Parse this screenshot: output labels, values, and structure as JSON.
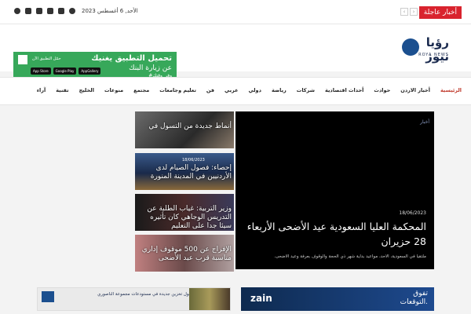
{
  "topbar": {
    "breaking_label": "أخبار عاجلة",
    "date": "الأحد, 6 أغسطس 2023",
    "social_icons": [
      "facebook-icon",
      "twitter-icon",
      "telegram-icon",
      "instagram-icon",
      "youtube-icon",
      "search-icon"
    ]
  },
  "header": {
    "logo_text": "رؤيا نيوز",
    "logo_sub": "ROYA NEWS",
    "app_banner": {
      "title": "تحميل التطبيق يغنيك",
      "subtitle": "عن زيارة البنك",
      "hashtag": "#وفر_وقتك",
      "cta": "حمّل التطبيق الآن",
      "stores": [
        "App Store",
        "Google Play",
        "AppGallery"
      ]
    }
  },
  "nav": {
    "items": [
      "الرئيسية",
      "أخبار الاردن",
      "حوادث",
      "أحداث اقتصادية",
      "شركات",
      "رياضة",
      "دولي",
      "عربي",
      "فن",
      "تعليم وجامعات",
      "مجتمع",
      "منوعات",
      "الخليج",
      "تقنية",
      "آراء"
    ]
  },
  "featured": {
    "tag": "أخبار",
    "date": "18/06/2023",
    "title": "المحكمة العليا السعودية عيد الأضحى الأربعاء 28 حزيران",
    "excerpt": "ملتقيا في السعودية، الأحد، مواعيد بداية شهر ذي الحجة والوقوف بعرفة وعيد الأضحى."
  },
  "side_posts": [
    {
      "date": "",
      "title": "أنماط جديدة من التسول في"
    },
    {
      "date": "18/06/2023",
      "title": "إحصاء: فصول الصيام لدى الأردنيين في المدينة المنورة"
    },
    {
      "date": "",
      "title": "وزير التربية: غياب الطلبة عن التدريس الوجاهي كان تأثيره سيئا جدا على التعليم"
    },
    {
      "date": "",
      "title": "الإفراج عن 500 موقوف إداري مناسبة قرب عيد الأضحى"
    }
  ],
  "ads": {
    "left_text": "حلول تخزين جديدة في مستودعات مجموعة الناصوري",
    "right_brand": "zain",
    "right_text_line1": "تفوق",
    "right_text_line2": "التوقعات."
  },
  "colors": {
    "accent": "#d9232e",
    "nav_active": "#c0392b",
    "app_green": "#37a85a",
    "brand_blue": "#1b4f8f"
  }
}
